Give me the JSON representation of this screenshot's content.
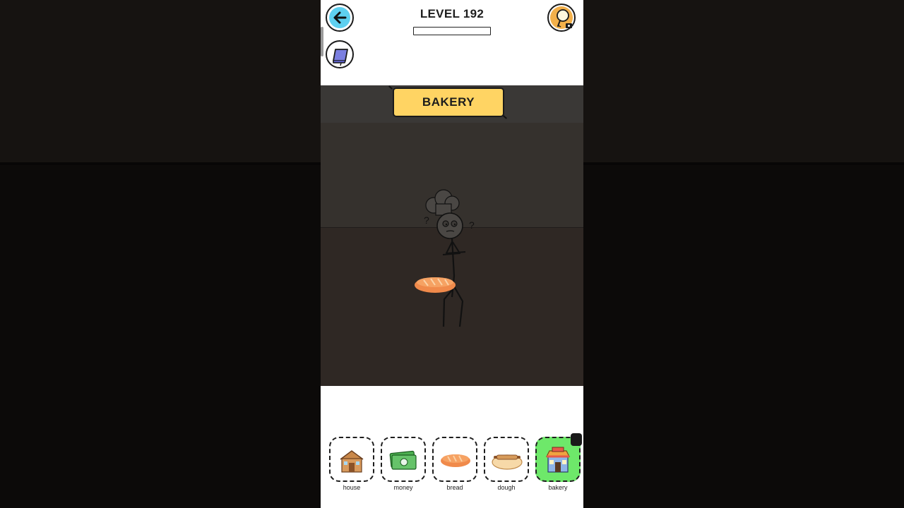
{
  "header": {
    "level_label": "LEVEL 192",
    "progress": 0
  },
  "scene": {
    "banner_text": "BAKERY",
    "thought_marks": [
      "?",
      "?"
    ],
    "character_icon": "chef-stickman-icon",
    "held_item_icon": "bread-icon"
  },
  "items": [
    {
      "label": "house",
      "icon": "house-icon",
      "selected": false
    },
    {
      "label": "money",
      "icon": "money-icon",
      "selected": false
    },
    {
      "label": "bread",
      "icon": "bread-icon",
      "selected": false
    },
    {
      "label": "dough",
      "icon": "dough-icon",
      "selected": false
    },
    {
      "label": "bakery",
      "icon": "bakery-shop-icon",
      "selected": true
    }
  ],
  "colors": {
    "banner": "#ffd463",
    "back_button": "#5ed0f0",
    "book_button": "#7b7fe0",
    "hint_button": "#f3b04a",
    "selected_item": "#6ee86a"
  }
}
